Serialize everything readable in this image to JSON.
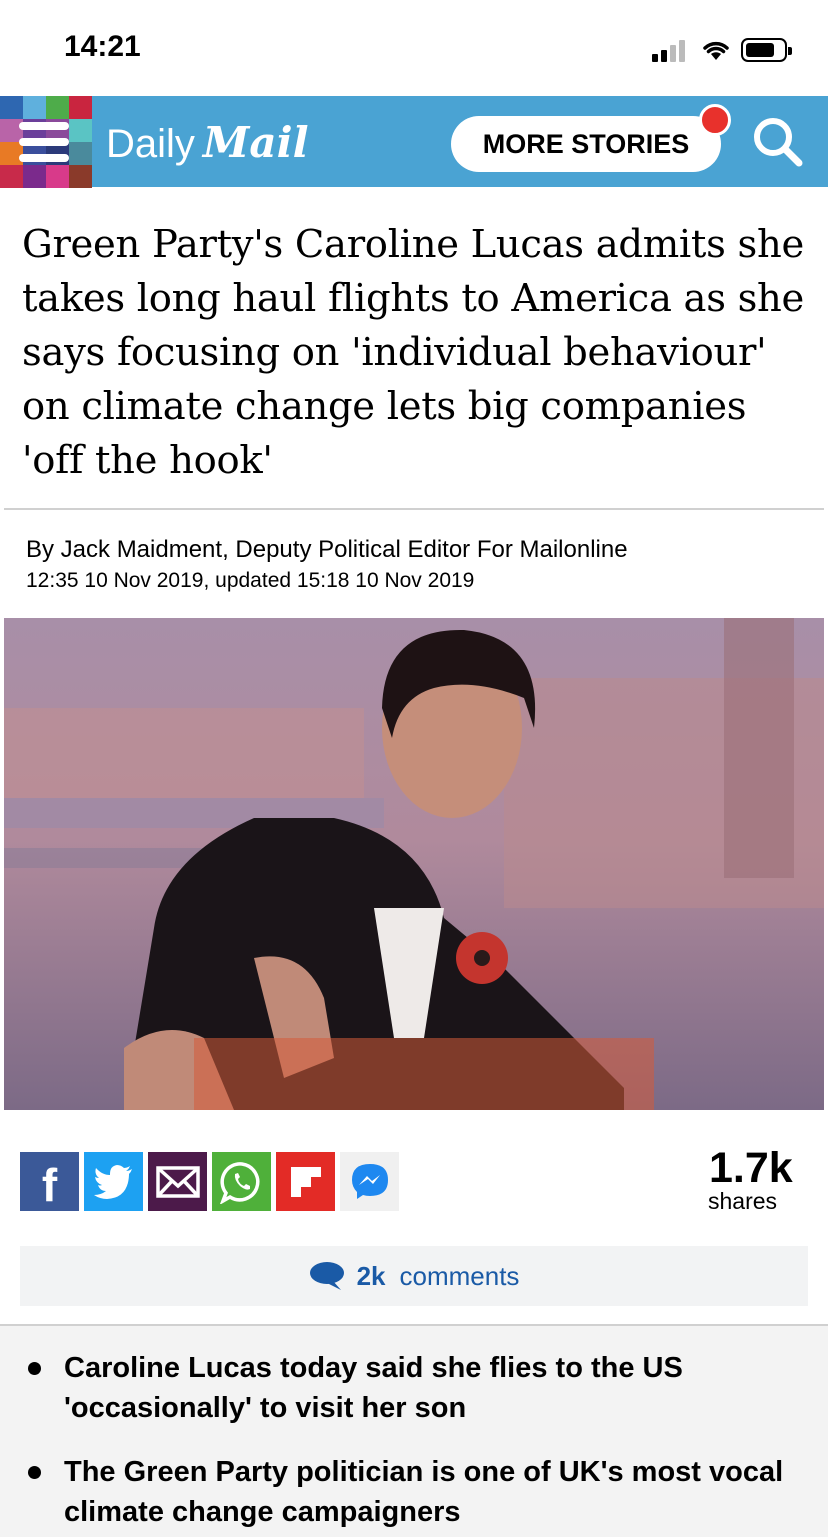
{
  "status_bar": {
    "time": "14:21"
  },
  "nav": {
    "logo_part1": "Daily",
    "logo_part2": "Mail",
    "more_stories_label": "MORE STORIES",
    "brand_color": "#4aa3d3",
    "notification_color": "#e8312c"
  },
  "article": {
    "headline": "Green Party's Caroline Lucas admits she takes long haul flights to America as she says focusing on 'individual behaviour' on climate change lets big companies 'off the hook'",
    "byline": "By Jack Maidment, Deputy Political Editor For Mailonline",
    "dateline": "12:35 10 Nov 2019, updated 15:18 10 Nov 2019"
  },
  "share_buttons": [
    {
      "icon": "facebook-icon",
      "color": "#3b5998"
    },
    {
      "icon": "twitter-icon",
      "color": "#1da1f2"
    },
    {
      "icon": "email-icon",
      "color": "#4c1a4a"
    },
    {
      "icon": "whatsapp-icon",
      "color": "#4fb03a"
    },
    {
      "icon": "flipboard-icon",
      "color": "#e32b26"
    },
    {
      "icon": "messenger-icon",
      "color": "#f0f0f0"
    }
  ],
  "shares": {
    "count": "1.7k",
    "label": "shares"
  },
  "comments": {
    "count": "2k",
    "label": "comments"
  },
  "bullets": [
    "Caroline Lucas today said she flies to the US 'occasionally' to visit her son",
    "The Green Party politician is one of UK's most vocal climate change campaigners"
  ]
}
